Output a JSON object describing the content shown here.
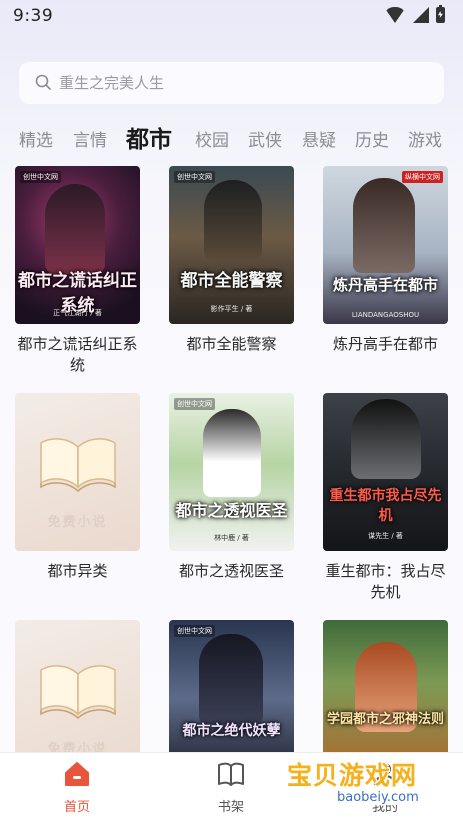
{
  "status_bar": {
    "time": "9:39"
  },
  "search": {
    "placeholder": "重生之完美人生"
  },
  "tabs": [
    {
      "label": "精选",
      "active": false
    },
    {
      "label": "言情",
      "active": false
    },
    {
      "label": "都市",
      "active": true
    },
    {
      "label": "校园",
      "active": false
    },
    {
      "label": "武侠",
      "active": false
    },
    {
      "label": "悬疑",
      "active": false
    },
    {
      "label": "历史",
      "active": false
    },
    {
      "label": "游戏",
      "active": false
    }
  ],
  "books": [
    {
      "title": "都市之谎话纠正系统",
      "cover_title": "都市之谎话纠正系统",
      "cover_author": "正气江湖行 / 著",
      "publisher": "创世中文网"
    },
    {
      "title": "都市全能警察",
      "cover_title": "都市全能警察",
      "cover_author": "影作平生 / 著",
      "publisher": "创世中文网"
    },
    {
      "title": "炼丹高手在都市",
      "cover_title": "炼丹高手在都市",
      "cover_author": "LIANDANGAOSHOU",
      "publisher": "纵横中文网"
    },
    {
      "title": "都市异类",
      "cover_title": "免费小说",
      "placeholder": true
    },
    {
      "title": "都市之透视医圣",
      "cover_title": "都市之透视医圣",
      "cover_author": "林中鹿 / 著",
      "publisher": "创世中文网"
    },
    {
      "title": "重生都市：我占尽先机",
      "cover_title": "重生都市我占尽先机",
      "cover_author": "谋先生 / 著",
      "publisher": ""
    },
    {
      "title": "",
      "cover_title": "免费小说",
      "placeholder": true
    },
    {
      "title": "",
      "cover_title": "都市之绝代妖孽",
      "publisher": "创世中文网"
    },
    {
      "title": "",
      "cover_title": "学园都市之邪神法则",
      "publisher": ""
    }
  ],
  "bottom_nav": [
    {
      "label": "首页",
      "icon": "home-icon",
      "active": true
    },
    {
      "label": "书架",
      "icon": "bookshelf-icon",
      "active": false
    },
    {
      "label": "我的",
      "icon": "profile-icon",
      "active": false
    }
  ],
  "watermark": {
    "title": "宝贝游戏网",
    "url": "baobeiy.com"
  },
  "colors": {
    "accent": "#e8553c",
    "tab_inactive": "#8c8c95",
    "watermark": "#f6b11a"
  }
}
